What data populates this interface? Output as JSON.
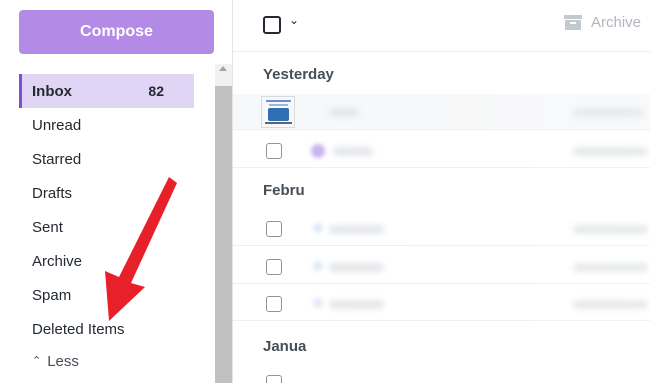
{
  "compose": {
    "label": "Compose"
  },
  "folders": [
    {
      "label": "Inbox",
      "count": "82"
    },
    {
      "label": "Unread"
    },
    {
      "label": "Starred"
    },
    {
      "label": "Drafts"
    },
    {
      "label": "Sent"
    },
    {
      "label": "Archive"
    },
    {
      "label": "Spam"
    },
    {
      "label": "Deleted Items"
    }
  ],
  "less": {
    "label": "Less"
  },
  "toolbar": {
    "archive_label": "Archive"
  },
  "groups": {
    "yesterday": "Yesterday",
    "february": "Febru",
    "january": "Janua"
  },
  "colors": {
    "compose_bg": "#b38be6",
    "active_folder_bg": "#e0d5f5",
    "accent": "#7b4fd0",
    "arrow": "#e8202a"
  },
  "icons": {
    "archive": "archive-box-icon",
    "arrow": "red-arrow-pointer",
    "select": "checkbox-icon"
  }
}
